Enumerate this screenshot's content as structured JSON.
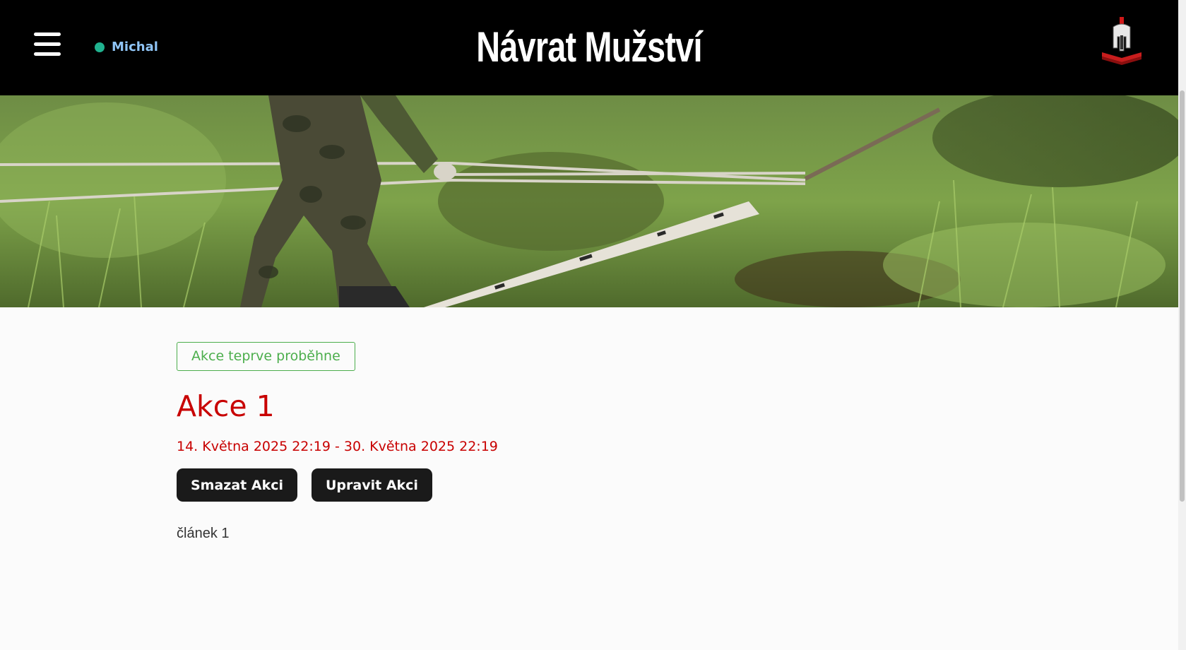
{
  "header": {
    "menu_icon": "hamburger-menu-icon",
    "user": {
      "name": "Michal",
      "status_color": "#20b28f",
      "name_color": "#8fc4f5"
    },
    "site_title": "Návrat Mužství",
    "logo_icon": "spartan-helmet-logo-icon"
  },
  "hero": {
    "image_description_icon": "hero-image"
  },
  "event": {
    "status": "Akce teprve proběhne",
    "title": "Akce 1",
    "dates": "14. Května 2025 22:19 - 30. Května 2025 22:19",
    "buttons": {
      "delete": "Smazat Akci",
      "edit": "Upravit Akci"
    },
    "body": "článek 1"
  },
  "colors": {
    "accent_red": "#c80000",
    "status_green": "#4cae4c",
    "header_bg": "#000000",
    "button_bg": "#1a1a1a"
  }
}
